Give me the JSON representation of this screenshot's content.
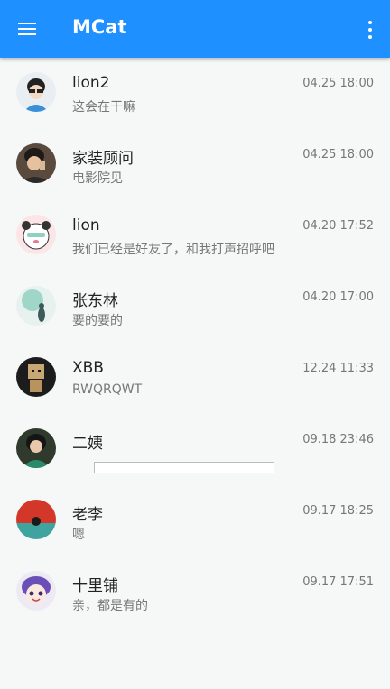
{
  "appbar": {
    "title": "MCat",
    "menu_icon": "menu-icon",
    "more_icon": "more-vert-icon",
    "color": "#1e90ff"
  },
  "chats": [
    {
      "name": "lion2",
      "time": "04.25 18:00",
      "message": "这会在干嘛",
      "avatar": "avatar-cartoon-boy"
    },
    {
      "name": "家装顾问",
      "time": "04.25 18:00",
      "message": "电影院见",
      "avatar": "avatar-person-photo"
    },
    {
      "name": "lion",
      "time": "04.20 17:52",
      "message": "我们已经是好友了，和我打声招呼吧",
      "avatar": "avatar-panda"
    },
    {
      "name": "张东林",
      "time": "04.20 17:00",
      "message": "要的要的",
      "avatar": "avatar-mint-figure"
    },
    {
      "name": "XBB",
      "time": "12.24 11:33",
      "message": "RWQRQWT",
      "avatar": "avatar-box-robot"
    },
    {
      "name": "二姨",
      "time": "09.18 23:46",
      "message": "",
      "avatar": "avatar-woman-photo"
    },
    {
      "name": "老李",
      "time": "09.17 18:25",
      "message": "嗯",
      "avatar": "avatar-sunset"
    },
    {
      "name": "十里铺",
      "time": "09.17 17:51",
      "message": "亲，都是有的",
      "avatar": "avatar-anime-girl"
    }
  ]
}
